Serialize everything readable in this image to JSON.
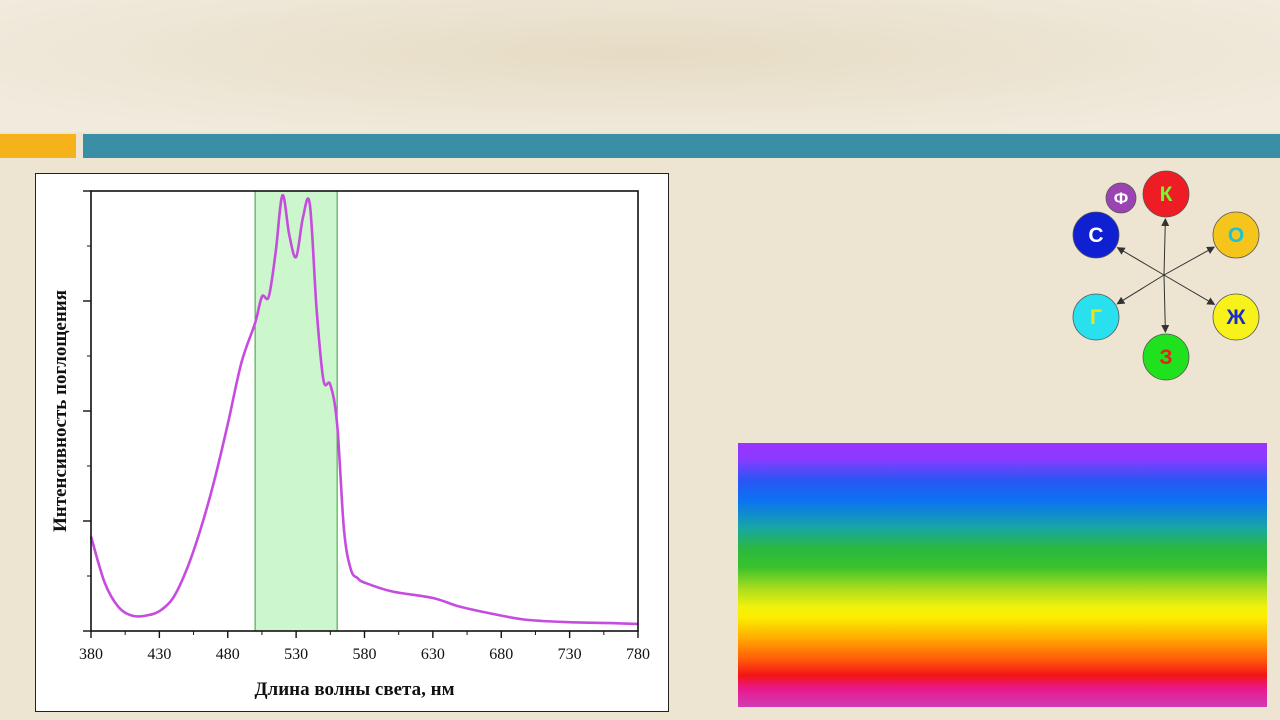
{
  "chart_data": {
    "type": "line",
    "xlabel": "Длина волны света, нм",
    "ylabel": "Интенсивность поглощения",
    "xlim": [
      380,
      780
    ],
    "ylim": [
      0,
      1
    ],
    "x_ticks": [
      380,
      430,
      480,
      530,
      580,
      630,
      680,
      730,
      780
    ],
    "grid": false,
    "highlight_band": {
      "from": 500,
      "to": 560,
      "color": "#ccf7cc"
    },
    "series": [
      {
        "color": "#c64cdf",
        "x": [
          380,
          390,
          400,
          410,
          420,
          430,
          440,
          450,
          460,
          470,
          480,
          490,
          500,
          505,
          510,
          515,
          520,
          525,
          530,
          535,
          540,
          545,
          550,
          555,
          560,
          565,
          570,
          575,
          580,
          600,
          630,
          650,
          680,
          700,
          730,
          760,
          780
        ],
        "y": [
          0.215,
          0.11,
          0.055,
          0.035,
          0.035,
          0.045,
          0.075,
          0.14,
          0.23,
          0.34,
          0.47,
          0.61,
          0.7,
          0.76,
          0.76,
          0.86,
          0.99,
          0.9,
          0.85,
          0.94,
          0.97,
          0.73,
          0.57,
          0.56,
          0.47,
          0.23,
          0.14,
          0.12,
          0.11,
          0.09,
          0.075,
          0.055,
          0.035,
          0.025,
          0.02,
          0.018,
          0.016
        ]
      }
    ]
  },
  "wheel": {
    "circles": [
      {
        "letter": "К",
        "fill": "#ee1c25",
        "text": "#6cff2a"
      },
      {
        "letter": "О",
        "fill": "#f5c51b",
        "text": "#19c4d8"
      },
      {
        "letter": "Ж",
        "fill": "#f7f21a",
        "text": "#1a2bd0"
      },
      {
        "letter": "З",
        "fill": "#20e11e",
        "text": "#e8201b"
      },
      {
        "letter": "Г",
        "fill": "#29e0ee",
        "text": "#f0e21a"
      },
      {
        "letter": "С",
        "fill": "#0f1fd2",
        "text": "#ffffff"
      },
      {
        "letter": "Ф",
        "fill": "#9c43b2",
        "text": "#ffffff"
      }
    ]
  },
  "colors": {
    "accent_orange": "#f6b21b",
    "accent_teal": "#3a8ea6",
    "background": "#ede4d1"
  }
}
